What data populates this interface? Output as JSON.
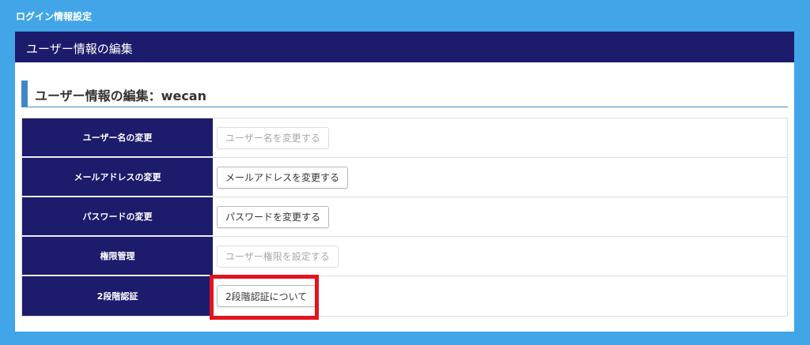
{
  "page": {
    "title": "ログイン情報設定"
  },
  "panel": {
    "header": "ユーザー情報の編集"
  },
  "section": {
    "heading": "ユーザー情報の編集：wecan"
  },
  "rows": [
    {
      "label": "ユーザー名の変更",
      "button": "ユーザー名を変更する",
      "enabled": false
    },
    {
      "label": "メールアドレスの変更",
      "button": "メールアドレスを変更する",
      "enabled": true
    },
    {
      "label": "パスワードの変更",
      "button": "パスワードを変更する",
      "enabled": true
    },
    {
      "label": "権限管理",
      "button": "ユーザー権限を設定する",
      "enabled": false
    },
    {
      "label": "2段階認証",
      "button": "2段階認証について",
      "enabled": true
    }
  ],
  "colors": {
    "background": "#42a5e8",
    "navy": "#1c1b6c",
    "accent_bar": "#3f86c6",
    "highlight": "#e3141e"
  }
}
